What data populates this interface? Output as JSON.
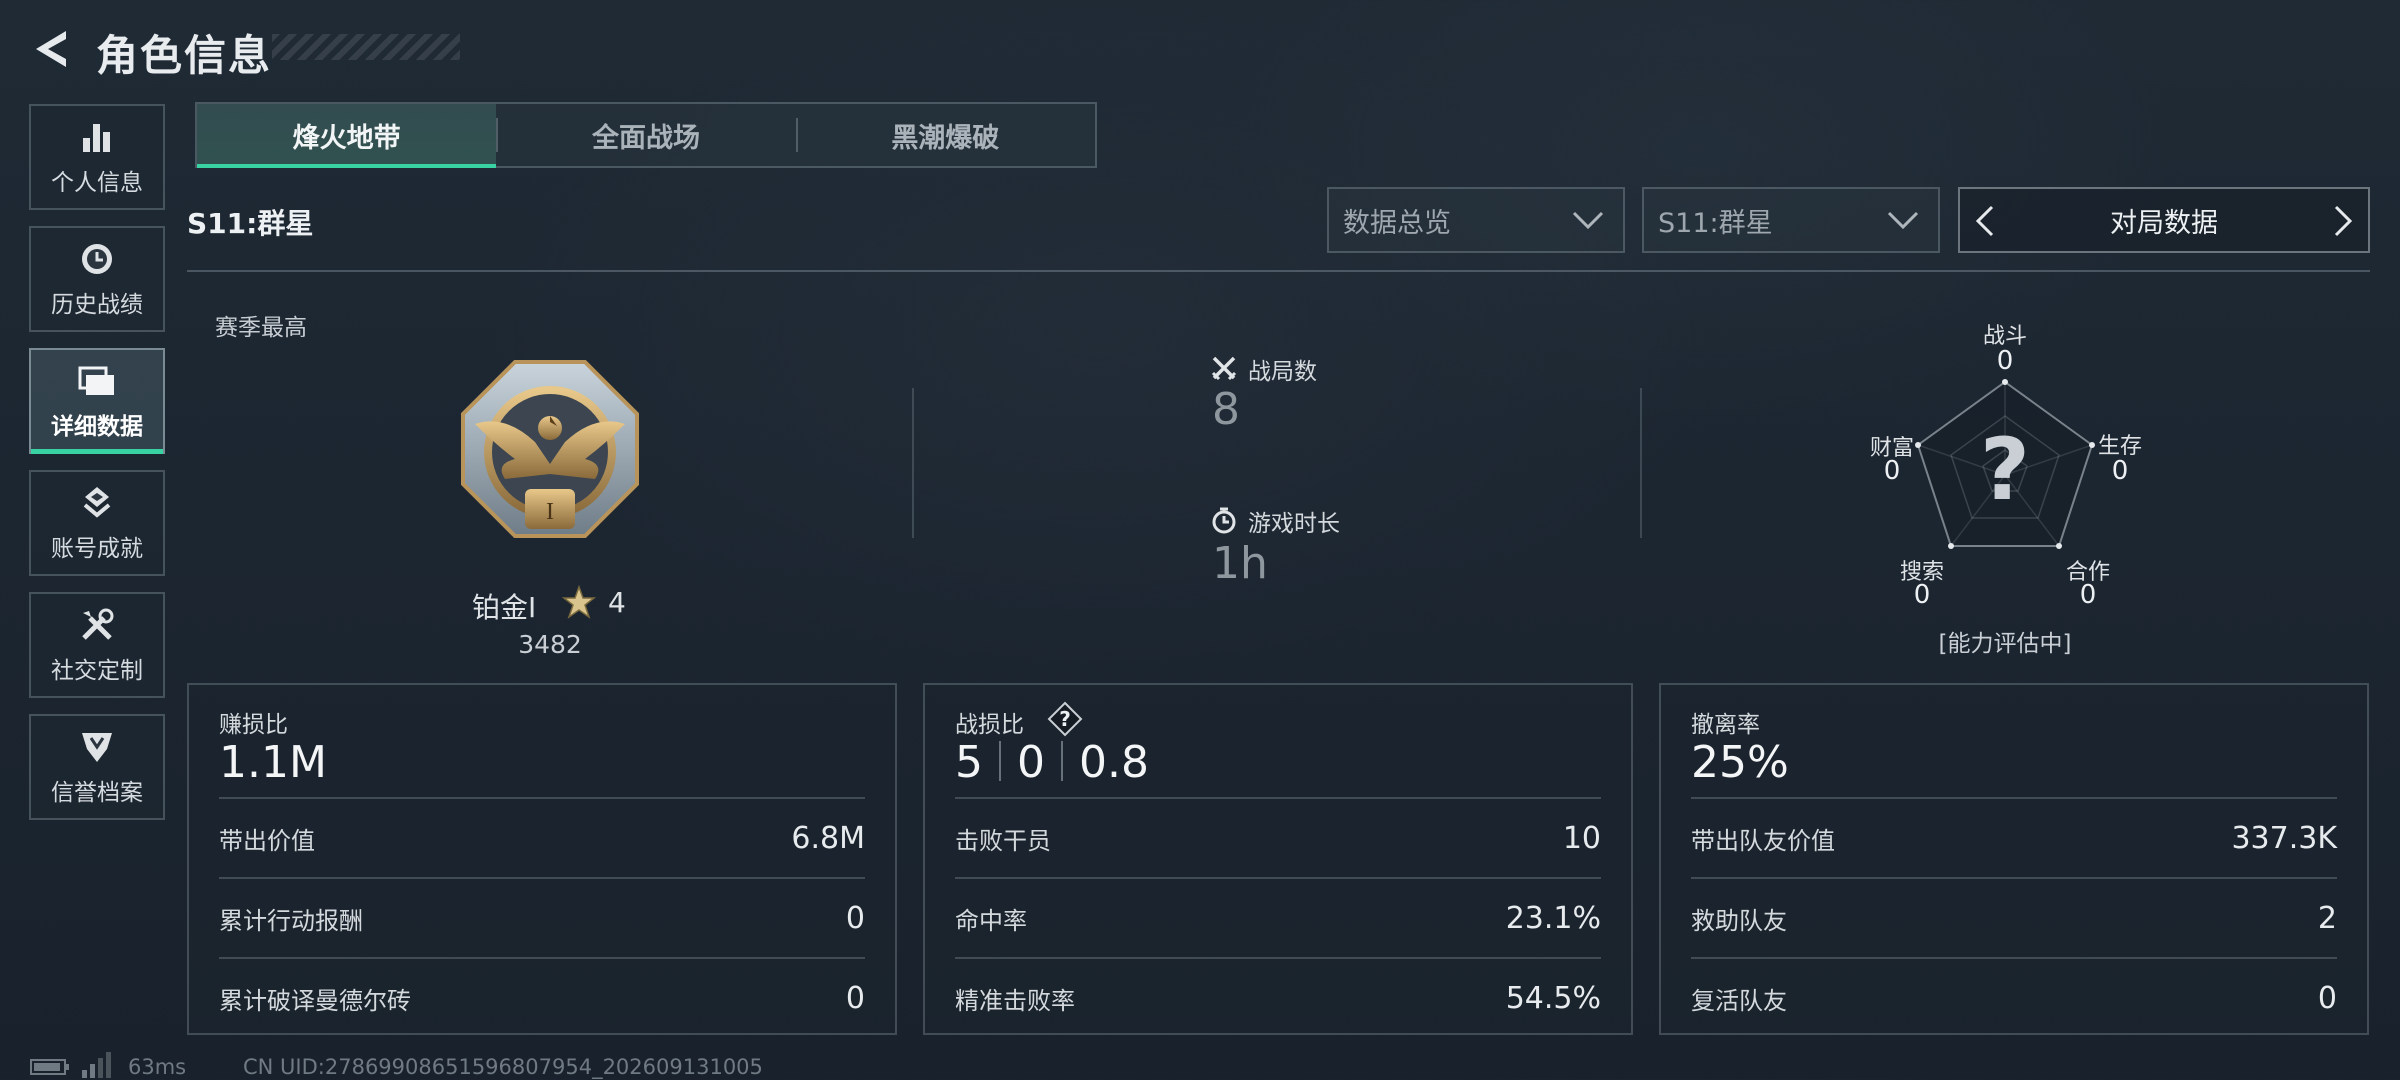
{
  "header": {
    "title": "角色信息"
  },
  "sidebar": {
    "items": [
      {
        "label": "个人信息",
        "icon": "bar-chart-icon"
      },
      {
        "label": "历史战绩",
        "icon": "history-clock-icon"
      },
      {
        "label": "详细数据",
        "icon": "folder-icon",
        "active": true
      },
      {
        "label": "账号成就",
        "icon": "achievement-icon"
      },
      {
        "label": "社交定制",
        "icon": "tools-icon"
      },
      {
        "label": "信誉档案",
        "icon": "shield-badge-icon"
      }
    ]
  },
  "mode_tabs": [
    {
      "label": "烽火地带",
      "active": true
    },
    {
      "label": "全面战场"
    },
    {
      "label": "黑潮爆破"
    }
  ],
  "season_title": "S11:群星",
  "filters": {
    "overview_value": "数据总览",
    "season_value": "S11:群星",
    "switcher_label": "对局数据"
  },
  "rank": {
    "caption": "赛季最高",
    "name": "铂金Ⅰ",
    "stars": "4",
    "score": "3482",
    "medal_numeral": "I"
  },
  "match_stats": {
    "matches_label": "战局数",
    "matches_value": "8",
    "playtime_label": "游戏时长",
    "playtime_value": "1h"
  },
  "radar": {
    "center_mark": "?",
    "status": "[能力评估中]",
    "axes": [
      {
        "label": "战斗",
        "value": "0"
      },
      {
        "label": "生存",
        "value": "0"
      },
      {
        "label": "合作",
        "value": "0"
      },
      {
        "label": "搜索",
        "value": "0"
      },
      {
        "label": "财富",
        "value": "0"
      }
    ]
  },
  "cards": {
    "profit": {
      "title": "赚损比",
      "big": "1.1M",
      "rows": [
        {
          "k": "带出价值",
          "v": "6.8M"
        },
        {
          "k": "累计行动报酬",
          "v": "0"
        },
        {
          "k": "累计破译曼德尔砖",
          "v": "0"
        }
      ]
    },
    "kda": {
      "title": "战损比",
      "help": "?",
      "kills": "5",
      "deaths": "0",
      "ratio": "0.8",
      "rows": [
        {
          "k": "击败干员",
          "v": "10"
        },
        {
          "k": "命中率",
          "v": "23.1%"
        },
        {
          "k": "精准击败率",
          "v": "54.5%"
        }
      ]
    },
    "extract": {
      "title": "撤离率",
      "big": "25%",
      "rows": [
        {
          "k": "带出队友价值",
          "v": "337.3K"
        },
        {
          "k": "救助队友",
          "v": "2"
        },
        {
          "k": "复活队友",
          "v": "0"
        }
      ]
    }
  },
  "footer": {
    "ping": "63ms",
    "uid": "CN UID:2786990865159680795​4_202609131005"
  }
}
